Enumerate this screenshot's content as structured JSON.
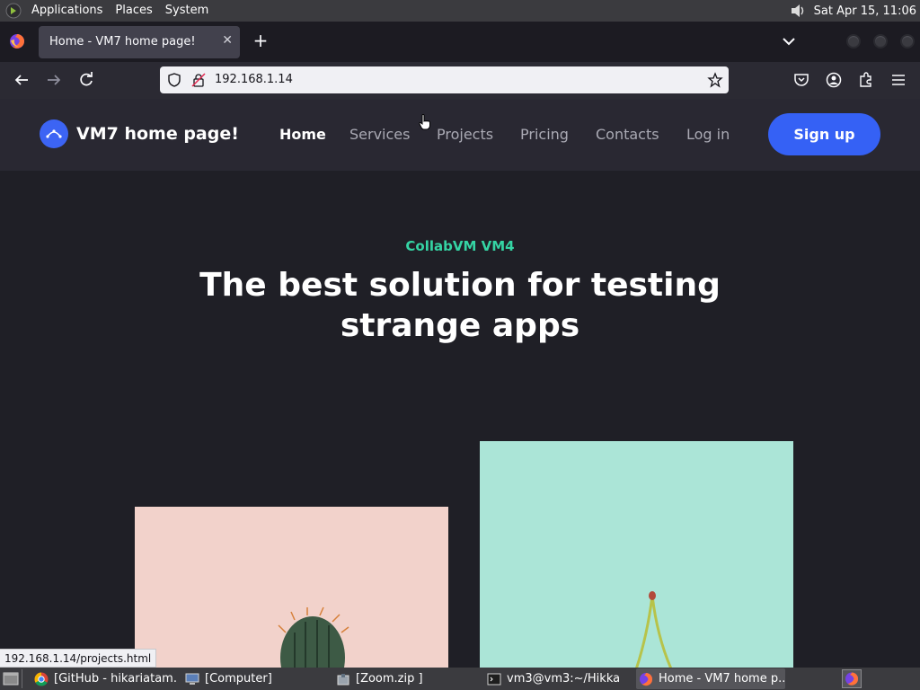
{
  "top_panel": {
    "menu": [
      "Applications",
      "Places",
      "System"
    ],
    "clock": "Sat Apr 15, 11:06"
  },
  "browser": {
    "tab_title": "Home - VM7 home page!",
    "url": "192.168.1.14",
    "status_url": "192.168.1.14/projects.html"
  },
  "site": {
    "brand": "VM7 home page!",
    "nav": [
      "Home",
      "Services",
      "Projects",
      "Pricing",
      "Contacts",
      "Log in"
    ],
    "signup": "Sign up",
    "hero_tag": "CollabVM VM4",
    "hero_title": "The best solution for testing strange apps"
  },
  "taskbar": {
    "items": [
      "[GitHub - hikariatam...",
      "[Computer]",
      "[Zoom.zip ]",
      "vm3@vm3:~/Hikka",
      "Home - VM7 home p..."
    ]
  },
  "colors": {
    "accent_blue": "#3561f5",
    "hero_tag_green": "#35d4a4",
    "page_bg": "#1f1f26",
    "header_bg": "#292832"
  }
}
